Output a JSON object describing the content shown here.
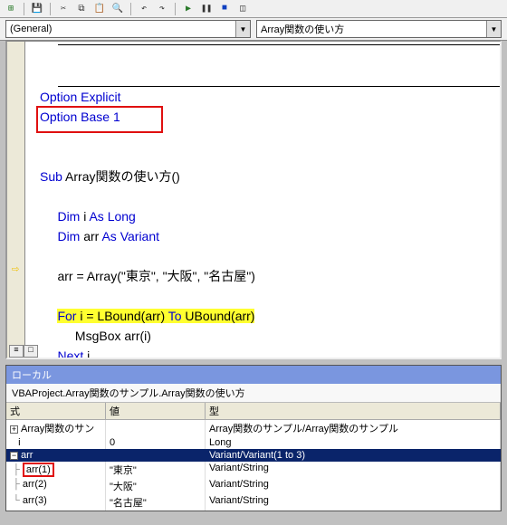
{
  "dropdowns": {
    "object": "(General)",
    "procedure": "Array関数の使い方"
  },
  "code": {
    "k_option_explicit": "Option Explicit",
    "k_option_base": "Option Base 1",
    "k_sub": "Sub",
    "proc_name": " Array関数の使い方()",
    "k_dim": "Dim",
    "var_i": " i ",
    "k_as_long": "As Long",
    "var_arr": " arr ",
    "k_as_variant": "As Variant",
    "assign": "arr = Array(\"東京\", \"大阪\", \"名古屋\")",
    "k_for": "For",
    "loop_expr": " i = LBound(arr) ",
    "k_to": "To",
    "loop_expr2": " UBound(arr)",
    "msgbox": "MsgBox arr(i)",
    "k_next": "Next",
    "next_var": " i"
  },
  "locals": {
    "title": "ローカル",
    "context": "VBAProject.Array関数のサンプル.Array関数の使い方",
    "headers": {
      "expr": "式",
      "value": "値",
      "type": "型"
    },
    "row_module": {
      "expr": "Array関数のサン",
      "value": "",
      "type": "Array関数のサンプル/Array関数のサンプル"
    },
    "row_i": {
      "expr": "i",
      "value": "0",
      "type": "Long"
    },
    "row_arr": {
      "expr": "arr",
      "value": "",
      "type": "Variant/Variant(1 to 3)"
    },
    "row_arr1": {
      "expr": "arr(1)",
      "value": "\"東京\"",
      "type": "Variant/String"
    },
    "row_arr2": {
      "expr": "arr(2)",
      "value": "\"大阪\"",
      "type": "Variant/String"
    },
    "row_arr3": {
      "expr": "arr(3)",
      "value": "\"名古屋\"",
      "type": "Variant/String"
    }
  }
}
